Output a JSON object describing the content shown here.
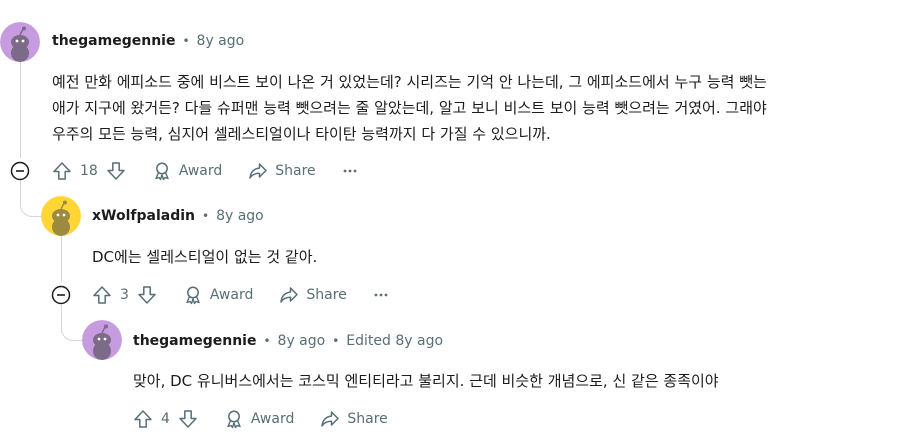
{
  "comments": [
    {
      "author": "thegamegennie",
      "time": "8y ago",
      "edited": "",
      "lines": [
        "예전 만화 에피소드 중에 비스트 보이 나온 거 있었는데? 시리즈는 기억 안 나는데, 그 에피소드에서 누구 능력 뺏는",
        "애가 지구에 왔거든? 다들 슈퍼맨 능력 뺏으려는 줄 알았는데, 알고 보니 비스트 보이 능력 뺏으려는 거였어. 그래야",
        "우주의 모든 능력, 심지어 셀레스티얼이나 타이탄 능력까지 다 가질 수 있으니까."
      ],
      "votes": "18",
      "award_label": "Award",
      "share_label": "Share",
      "avatar_color": "#c79bdf"
    },
    {
      "author": "xWolfpaladin",
      "time": "8y ago",
      "edited": "",
      "lines": [
        "DC에는 셀레스티얼이 없는 것 같아."
      ],
      "votes": "3",
      "award_label": "Award",
      "share_label": "Share",
      "avatar_color": "#ffd635"
    },
    {
      "author": "thegamegennie",
      "time": "8y ago",
      "edited": "Edited 8y ago",
      "lines": [
        "맞아, DC 유니버스에서는 코스믹 엔티티라고 불리지. 근데 비슷한 개념으로, 신 같은 종족이야"
      ],
      "votes": "4",
      "award_label": "Award",
      "share_label": "Share",
      "avatar_color": "#c79bdf"
    }
  ]
}
